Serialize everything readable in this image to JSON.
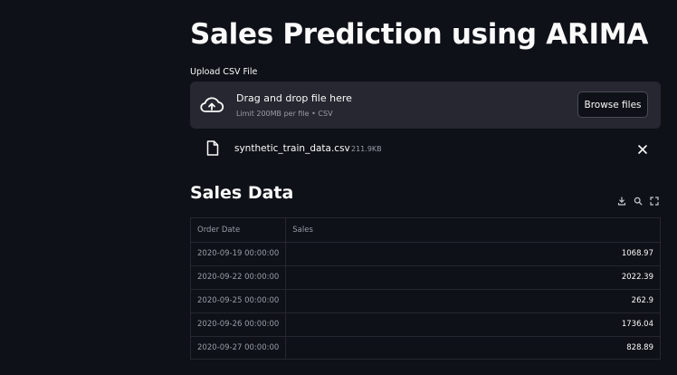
{
  "page": {
    "title": "Sales Prediction using ARIMA"
  },
  "uploader": {
    "label": "Upload CSV File",
    "drop_title": "Drag and drop file here",
    "drop_subtitle": "Limit 200MB per file • CSV",
    "browse_label": "Browse files",
    "upload_icon": "cloud-upload-icon",
    "file": {
      "name": "synthetic_train_data.csv",
      "size": "211.9KB",
      "icon": "file-icon",
      "remove_icon": "close-icon"
    }
  },
  "sales_data": {
    "title": "Sales Data",
    "toolbar_icons": [
      "download-icon",
      "search-icon",
      "fullscreen-icon"
    ],
    "columns": [
      "Order Date",
      "Sales"
    ],
    "rows": [
      {
        "date": "2020-09-19 00:00:00",
        "sales": "1068.97"
      },
      {
        "date": "2020-09-22 00:00:00",
        "sales": "2022.39"
      },
      {
        "date": "2020-09-25 00:00:00",
        "sales": "262.9"
      },
      {
        "date": "2020-09-26 00:00:00",
        "sales": "1736.04"
      },
      {
        "date": "2020-09-27 00:00:00",
        "sales": "828.89"
      }
    ]
  },
  "colors": {
    "background": "#0e1117",
    "panel": "#262730",
    "text": "#fafafa",
    "muted": "#9a9ca6"
  }
}
